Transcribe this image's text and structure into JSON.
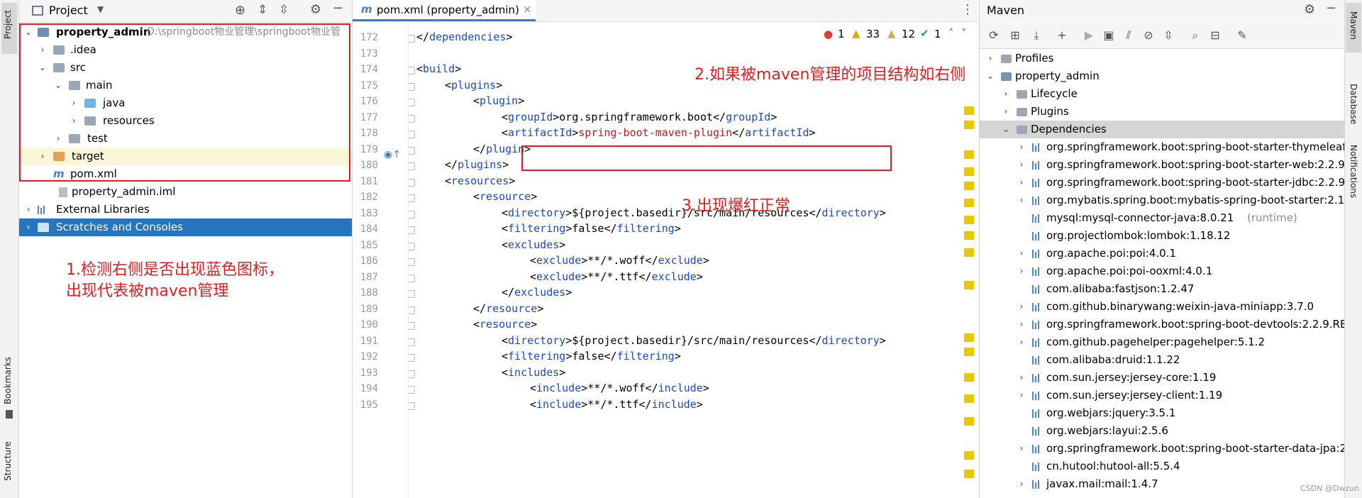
{
  "left_stripe": {
    "project": "Project",
    "bookmarks": "Bookmarks",
    "structure": "Structure"
  },
  "project": {
    "title": "Project",
    "tree": [
      {
        "label": "property_admin",
        "path": "D:\\springboot物业管理\\springboot物业管",
        "bold": true
      },
      {
        "label": ".idea"
      },
      {
        "label": "src"
      },
      {
        "label": "main"
      },
      {
        "label": "java"
      },
      {
        "label": "resources"
      },
      {
        "label": "test"
      },
      {
        "label": "target"
      },
      {
        "label": "pom.xml"
      },
      {
        "label": "property_admin.iml"
      },
      {
        "label": "External Libraries"
      },
      {
        "label": "Scratches and Consoles"
      }
    ],
    "annotation_line1": "1.检测右侧是否出现蓝色图标，",
    "annotation_line2": "出现代表被maven管理"
  },
  "editor": {
    "tab_label": "pom.xml (property_admin)",
    "tab_close": "×",
    "inspection": {
      "errors": "1",
      "warnings": "33",
      "weak_warnings": "12",
      "ok": "1"
    },
    "lines": [
      {
        "n": "172",
        "indent": 1,
        "html": "</dependencies>"
      },
      {
        "n": "173",
        "indent": 0,
        "html": ""
      },
      {
        "n": "174",
        "indent": 1,
        "html": "<build>"
      },
      {
        "n": "175",
        "indent": 2,
        "html": "<plugins>"
      },
      {
        "n": "176",
        "indent": 3,
        "html": "<plugin>"
      },
      {
        "n": "177",
        "indent": 4,
        "html": "<groupId>org.springframework.boot</groupId>"
      },
      {
        "n": "178",
        "indent": 4,
        "html": "<artifactId>spring-boot-maven-plugin</artifactId>"
      },
      {
        "n": "179",
        "indent": 3,
        "html": "</plugin>"
      },
      {
        "n": "180",
        "indent": 2,
        "html": "</plugins>"
      },
      {
        "n": "181",
        "indent": 2,
        "html": "<resources>"
      },
      {
        "n": "182",
        "indent": 3,
        "html": "<resource>"
      },
      {
        "n": "183",
        "indent": 4,
        "html": "<directory>${project.basedir}/src/main/resources</directory>"
      },
      {
        "n": "184",
        "indent": 4,
        "html": "<filtering>false</filtering>"
      },
      {
        "n": "185",
        "indent": 4,
        "html": "<excludes>"
      },
      {
        "n": "186",
        "indent": 5,
        "html": "<exclude>**/*.woff</exclude>"
      },
      {
        "n": "187",
        "indent": 5,
        "html": "<exclude>**/*.ttf</exclude>"
      },
      {
        "n": "188",
        "indent": 4,
        "html": "</excludes>"
      },
      {
        "n": "189",
        "indent": 3,
        "html": "</resource>"
      },
      {
        "n": "190",
        "indent": 3,
        "html": "<resource>"
      },
      {
        "n": "191",
        "indent": 4,
        "html": "<directory>${project.basedir}/src/main/resources</directory>"
      },
      {
        "n": "192",
        "indent": 4,
        "html": "<filtering>false</filtering>"
      },
      {
        "n": "193",
        "indent": 4,
        "html": "<includes>"
      },
      {
        "n": "194",
        "indent": 5,
        "html": "<include>**/*.woff</include>"
      },
      {
        "n": "195",
        "indent": 5,
        "html": "<include>**/*.ttf</include>"
      }
    ],
    "annotation_maven": "2.如果被maven管理的项目结构如右侧",
    "annotation_red": "3.出现爆红正常"
  },
  "maven": {
    "title": "Maven",
    "tree": [
      {
        "label": "Profiles",
        "level": 0,
        "arrow": "right"
      },
      {
        "label": "property_admin",
        "level": 0,
        "arrow": "down"
      },
      {
        "label": "Lifecycle",
        "level": 1,
        "arrow": "right"
      },
      {
        "label": "Plugins",
        "level": 1,
        "arrow": "right"
      },
      {
        "label": "Dependencies",
        "level": 1,
        "arrow": "down",
        "selected": true
      },
      {
        "label": "org.springframework.boot:spring-boot-starter-thymeleaf",
        "level": 2,
        "arrow": "right"
      },
      {
        "label": "org.springframework.boot:spring-boot-starter-web:2.2.9",
        "level": 2,
        "arrow": "right"
      },
      {
        "label": "org.springframework.boot:spring-boot-starter-jdbc:2.2.9",
        "level": 2,
        "arrow": "right"
      },
      {
        "label": "org.mybatis.spring.boot:mybatis-spring-boot-starter:2.1.",
        "level": 2,
        "arrow": "right"
      },
      {
        "label": "mysql:mysql-connector-java:8.0.21",
        "suffix": " (runtime)",
        "level": 2,
        "arrow": ""
      },
      {
        "label": "org.projectlombok:lombok:1.18.12",
        "level": 2,
        "arrow": ""
      },
      {
        "label": "org.apache.poi:poi:4.0.1",
        "level": 2,
        "arrow": "right"
      },
      {
        "label": "org.apache.poi:poi-ooxml:4.0.1",
        "level": 2,
        "arrow": "right"
      },
      {
        "label": "com.alibaba:fastjson:1.2.47",
        "level": 2,
        "arrow": ""
      },
      {
        "label": "com.github.binarywang:weixin-java-miniapp:3.7.0",
        "level": 2,
        "arrow": "right"
      },
      {
        "label": "org.springframework.boot:spring-boot-devtools:2.2.9.RE",
        "level": 2,
        "arrow": "right"
      },
      {
        "label": "com.github.pagehelper:pagehelper:5.1.2",
        "level": 2,
        "arrow": "right"
      },
      {
        "label": "com.alibaba:druid:1.1.22",
        "level": 2,
        "arrow": ""
      },
      {
        "label": "com.sun.jersey:jersey-core:1.19",
        "level": 2,
        "arrow": "right"
      },
      {
        "label": "com.sun.jersey:jersey-client:1.19",
        "level": 2,
        "arrow": "right"
      },
      {
        "label": "org.webjars:jquery:3.5.1",
        "level": 2,
        "arrow": ""
      },
      {
        "label": "org.webjars:layui:2.5.6",
        "level": 2,
        "arrow": ""
      },
      {
        "label": "org.springframework.boot:spring-boot-starter-data-jpa:2",
        "level": 2,
        "arrow": "right"
      },
      {
        "label": "cn.hutool:hutool-all:5.5.4",
        "level": 2,
        "arrow": ""
      },
      {
        "label": "javax.mail:mail:1.4.7",
        "level": 2,
        "arrow": "right"
      }
    ]
  },
  "right_stripe": {
    "maven": "Maven",
    "database": "Database",
    "notifications": "Notifications"
  },
  "watermark": "CSDN @Dwzun"
}
